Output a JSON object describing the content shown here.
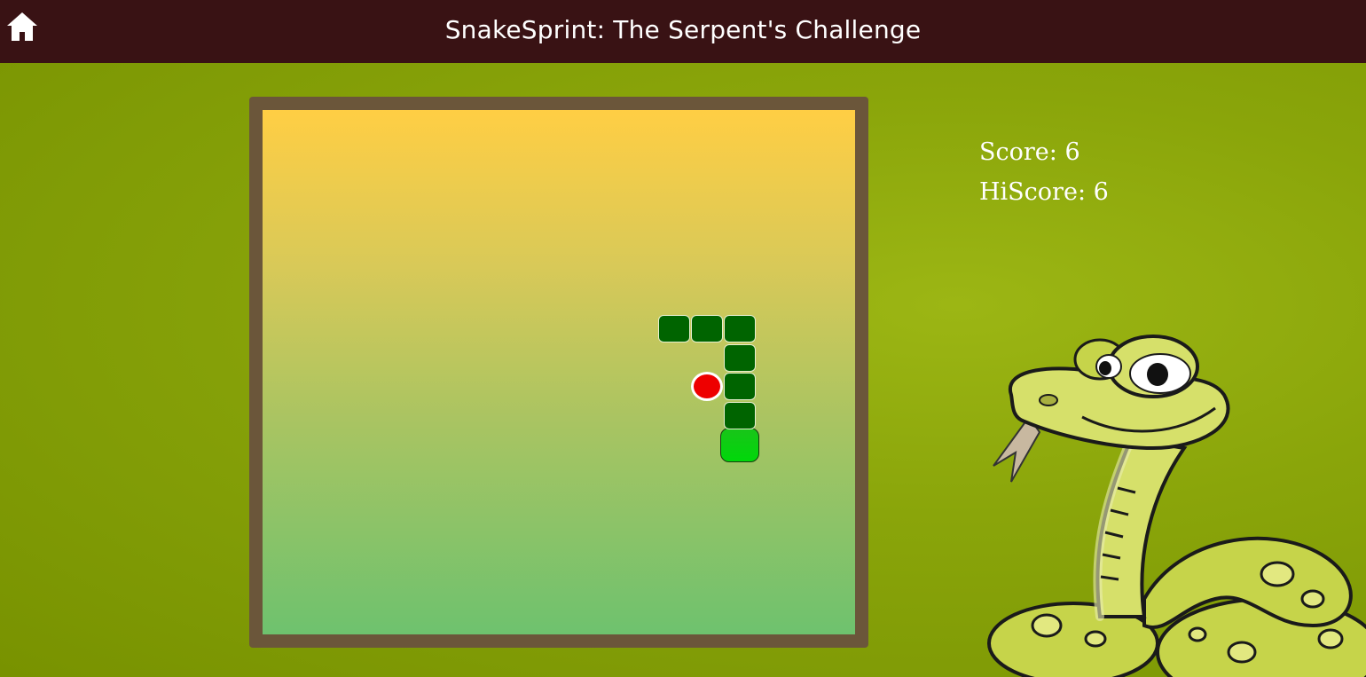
{
  "header": {
    "title": "SnakeSprint: The Serpent's Challenge",
    "home_icon": "home-icon",
    "background_color": "#391214"
  },
  "game": {
    "board_gradient_top": "#ffce44",
    "board_gradient_bottom": "#6ec26e",
    "frame_color": "#6b563a",
    "snake_color": "#006400",
    "snake_head_color": "#00d80a",
    "food_color": "#ee0000",
    "grid": {
      "columns": 18,
      "rows": 18
    },
    "snake": [
      {
        "col": 14,
        "row": 11
      },
      {
        "col": 14,
        "row": 10
      },
      {
        "col": 14,
        "row": 9
      },
      {
        "col": 14,
        "row": 8
      },
      {
        "col": 14,
        "row": 7
      },
      {
        "col": 13,
        "row": 7
      },
      {
        "col": 12,
        "row": 7
      }
    ],
    "food": {
      "col": 13,
      "row": 9
    }
  },
  "scoreboard": {
    "score_label": "Score: 6",
    "hiscore_label": "HiScore: 6",
    "score": 6,
    "hiscore": 6
  },
  "decor": {
    "mascot_icon": "cartoon-snake-mascot"
  }
}
